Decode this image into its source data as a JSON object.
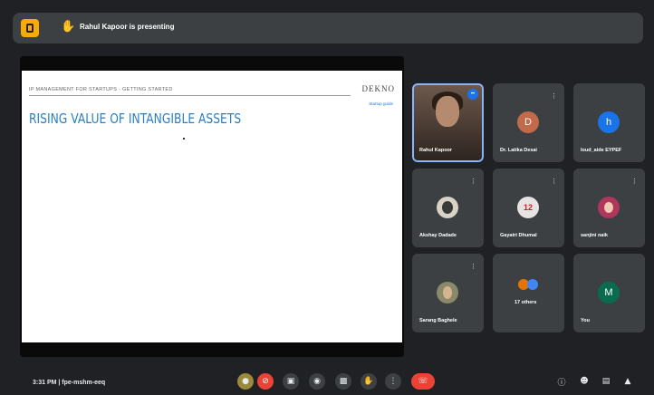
{
  "topbar": {
    "presenting_text": "Rahul Kapoor is presenting"
  },
  "slide": {
    "header": "IP MANAGEMENT FOR STARTUPS - GETTING STARTED",
    "brand": "DEKNO",
    "brand_sub": "Startup guide",
    "title": "RISING VALUE OF INTANGIBLE ASSETS"
  },
  "participants": [
    {
      "name": "Rahul Kapoor",
      "initial": "",
      "type": "video",
      "avatar_color": ""
    },
    {
      "name": "Dr. Latika Desai",
      "initial": "D",
      "type": "avatar",
      "avatar_color": "#c26a4a"
    },
    {
      "name": "loud_aide EYPEF",
      "initial": "h",
      "type": "avatar",
      "avatar_color": "#1a73e8"
    },
    {
      "name": "Akshay Dadade",
      "initial": "",
      "type": "photo",
      "avatar_color": "#d9d3c6"
    },
    {
      "name": "Gayatri Dhumal",
      "initial": "12",
      "type": "avatar",
      "avatar_color": "#e8e3e3"
    },
    {
      "name": "sanjini naik",
      "initial": "",
      "type": "photo",
      "avatar_color": "#b1365b"
    },
    {
      "name": "Sarang Baghele",
      "initial": "",
      "type": "photo",
      "avatar_color": "#8a8a6a"
    },
    {
      "name": "17 others",
      "initial": "",
      "type": "others",
      "avatar_color": ""
    },
    {
      "name": "You",
      "initial": "M",
      "type": "avatar",
      "avatar_color": "#0b6b4f"
    }
  ],
  "bottombar": {
    "status": "3:31 PM | fpe-mshm-eeq"
  },
  "colors": {
    "background": "#202124",
    "tile": "#3c4043",
    "end_call": "#ea4335",
    "title_blue": "#2a7fc1"
  }
}
